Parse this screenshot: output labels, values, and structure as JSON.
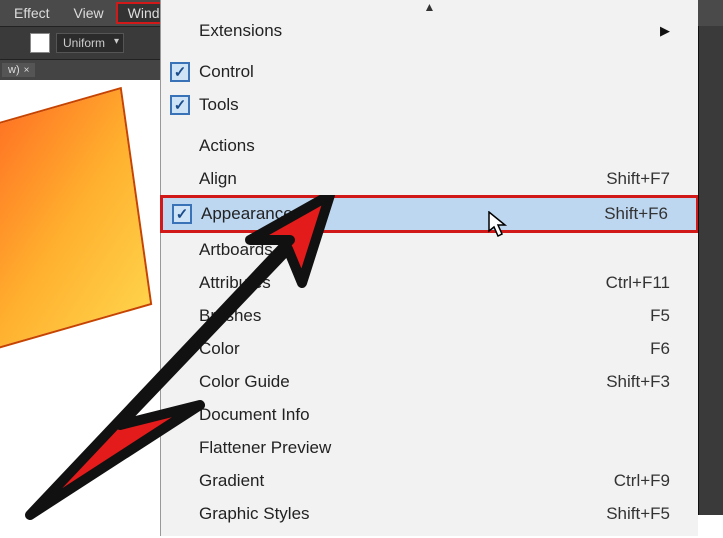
{
  "menubar": {
    "items": [
      "Effect",
      "View",
      "Window"
    ]
  },
  "toolbar": {
    "stroke_style": "Uniform"
  },
  "doctab": {
    "label": "w)",
    "close": "×"
  },
  "menu": {
    "scroll_up": "▲",
    "extensions": {
      "label": "Extensions",
      "arrow": "▶"
    },
    "control": {
      "label": "Control"
    },
    "tools": {
      "label": "Tools"
    },
    "items": [
      {
        "label": "Actions",
        "shortcut": ""
      },
      {
        "label": "Align",
        "shortcut": "Shift+F7"
      }
    ],
    "appearance": {
      "label": "Appearance",
      "shortcut": "Shift+F6"
    },
    "rest": [
      {
        "label": "Artboards",
        "shortcut": ""
      },
      {
        "label": "Attributes",
        "shortcut": "Ctrl+F11"
      },
      {
        "label": "Brushes",
        "shortcut": "F5"
      },
      {
        "label": "Color",
        "shortcut": "F6"
      },
      {
        "label": "Color Guide",
        "shortcut": "Shift+F3"
      },
      {
        "label": "Document Info",
        "shortcut": ""
      },
      {
        "label": "Flattener Preview",
        "shortcut": ""
      },
      {
        "label": "Gradient",
        "shortcut": "Ctrl+F9"
      },
      {
        "label": "Graphic Styles",
        "shortcut": "Shift+F5"
      }
    ]
  }
}
